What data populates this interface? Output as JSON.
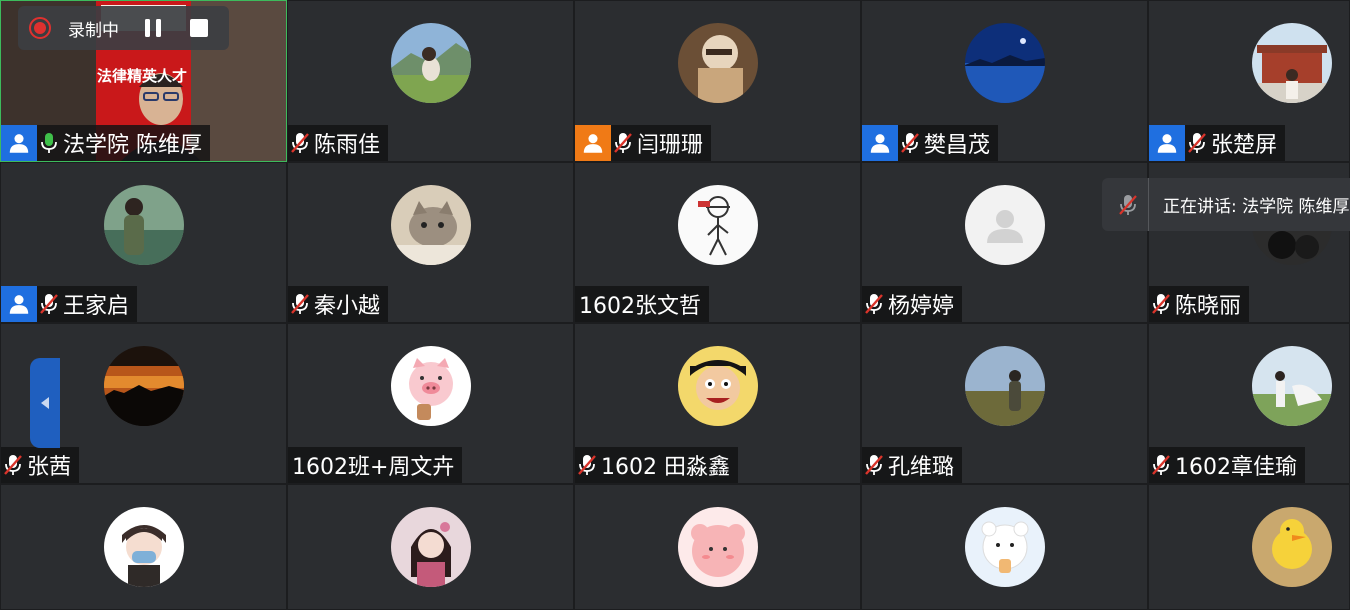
{
  "recording": {
    "status": "录制中",
    "dot_color": "#e0312f"
  },
  "speaking_popup": {
    "text": "正在讲话: 法学院 陈维厚"
  },
  "video_overlay": {
    "banner_text": "法律精英人才"
  },
  "participants": [
    {
      "name": "法学院 陈维厚",
      "user_icon": "blue",
      "mic": "on",
      "video": true
    },
    {
      "name": "陈雨佳",
      "user_icon": "",
      "mic": "muted",
      "avatar": "photo-green-field"
    },
    {
      "name": "闫珊珊",
      "user_icon": "orange",
      "mic": "muted",
      "avatar": "photo-warm-cafe"
    },
    {
      "name": "樊昌茂",
      "user_icon": "blue",
      "mic": "muted",
      "avatar": "photo-blue-lake"
    },
    {
      "name": "张楚屏",
      "user_icon": "blue",
      "mic": "muted",
      "avatar": "photo-palace"
    },
    {
      "name": "王家启",
      "user_icon": "blue",
      "mic": "muted",
      "avatar": "photo-person-river"
    },
    {
      "name": "秦小越",
      "user_icon": "",
      "mic": "muted",
      "avatar": "photo-cat"
    },
    {
      "name": "1602张文哲",
      "user_icon": "",
      "mic": "none",
      "avatar": "sketch-figure"
    },
    {
      "name": "杨婷婷",
      "user_icon": "",
      "mic": "muted",
      "avatar": "default-user"
    },
    {
      "name": "陈晓丽",
      "user_icon": "",
      "mic": "muted",
      "avatar": "photo-dark"
    },
    {
      "name": "张茜",
      "user_icon": "",
      "mic": "muted",
      "avatar": "photo-sunset"
    },
    {
      "name": "1602班+周文卉",
      "user_icon": "",
      "mic": "none",
      "avatar": "cartoon-pig"
    },
    {
      "name": "1602 田淼鑫",
      "user_icon": "",
      "mic": "muted",
      "avatar": "cartoon-boy"
    },
    {
      "name": "孔维璐",
      "user_icon": "",
      "mic": "muted",
      "avatar": "photo-grassland"
    },
    {
      "name": "1602章佳瑜",
      "user_icon": "",
      "mic": "muted",
      "avatar": "photo-field-girl"
    },
    {
      "name": "",
      "user_icon": "",
      "mic": "none",
      "avatar": "cartoon-masked-boy"
    },
    {
      "name": "",
      "user_icon": "",
      "mic": "none",
      "avatar": "photo-hanfu-girl"
    },
    {
      "name": "",
      "user_icon": "",
      "mic": "none",
      "avatar": "cartoon-pink-blob"
    },
    {
      "name": "",
      "user_icon": "",
      "mic": "none",
      "avatar": "cartoon-white-bear"
    },
    {
      "name": "",
      "user_icon": "",
      "mic": "none",
      "avatar": "cartoon-yellow-duck"
    }
  ],
  "colors": {
    "tile_bg": "#2b2d30",
    "active_border": "#3dbb5c",
    "user_icon_blue": "#1f6fe0",
    "user_icon_orange": "#f07a16",
    "muted_red": "#d9342b"
  }
}
